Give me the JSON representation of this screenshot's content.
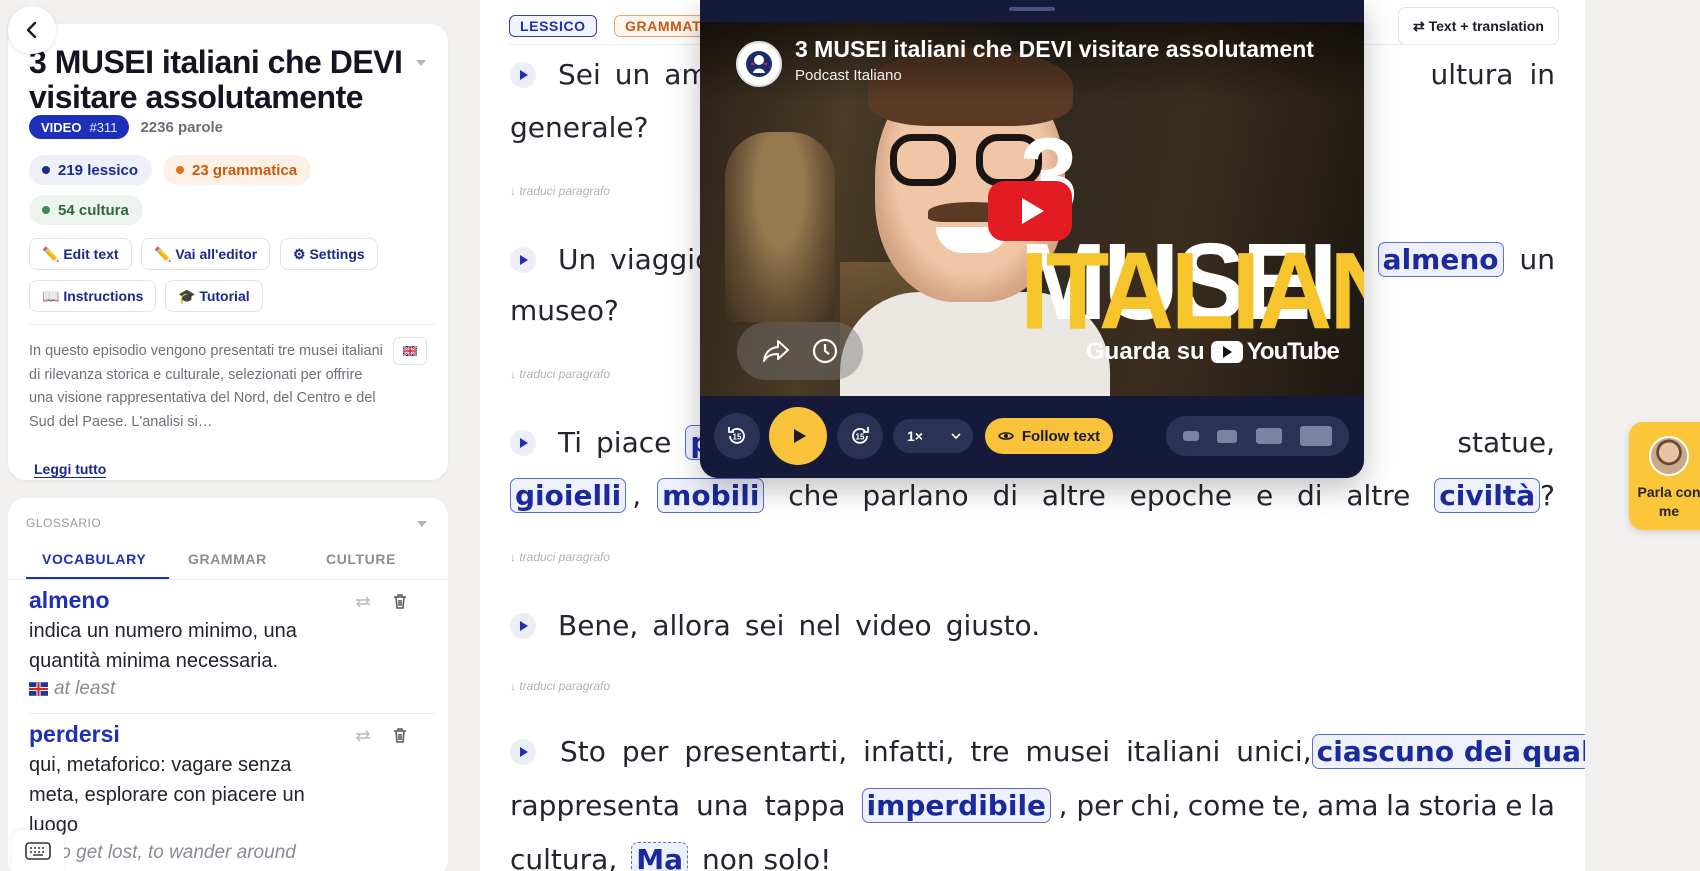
{
  "sidebar": {
    "title": "3 MUSEI italiani che DEVI visitare assolutamente",
    "video_badge": "VIDEO",
    "video_number": "#311",
    "word_count": "2236 parole",
    "stats": {
      "lessico": "219 lessico",
      "grammatica": "23 grammatica",
      "cultura": "54 cultura"
    },
    "buttons": {
      "edit_text": "✏️ Edit text",
      "editor": "✏️ Vai all'editor",
      "settings": "⚙ Settings",
      "instructions": "📖 Instructions",
      "tutorial": "🎓 Tutorial"
    },
    "description": "In questo episodio vengono presentati tre musei italiani di rilevanza storica e culturale, selezionati per offrire una visione rappresentativa del Nord, del Centro e del Sud del Paese. L'analisi si…",
    "read_all": "Leggi tutto"
  },
  "glossary": {
    "label": "GLOSSARIO",
    "tabs": [
      "VOCABULARY",
      "GRAMMAR",
      "CULTURE"
    ],
    "entries": [
      {
        "term": "almeno",
        "definition": "indica un numero minimo, una quantità minima necessaria.",
        "translation": "at least"
      },
      {
        "term": "perdersi",
        "definition": "qui, metaforico: vagare senza meta, esplorare con piacere un luogo",
        "translation": "to get lost, to wander around"
      }
    ]
  },
  "reader": {
    "tags": {
      "lessico": "LESSICO",
      "grammatica": "GRAMMATICA"
    },
    "translation_toggle": "⇄ Text + translation",
    "translate_hint": "↓ traduci paragrafo",
    "paragraphs": {
      "p1": {
        "lead": [
          "Sei",
          "un",
          "ama"
        ],
        "tail": [
          "ultura",
          "in"
        ],
        "line2": "generale?"
      },
      "p2": {
        "lead": [
          "Un",
          "viaggio,"
        ],
        "hl": "almeno",
        "tail": "un",
        "line2": "museo?"
      },
      "p3": {
        "lead": [
          "Ti",
          "piace"
        ],
        "hl_cut": "pe",
        "tail": "statue,",
        "line2_hl": [
          "gioielli",
          "mobili",
          "civiltà"
        ],
        "line2_text": [
          "che",
          "parlano",
          "di",
          "altre",
          "epoche",
          "e",
          "di",
          "altre"
        ]
      },
      "p4": {
        "words": [
          "Bene,",
          "allora",
          "sei",
          "nel",
          "video",
          "giusto."
        ]
      },
      "p5": {
        "lead": [
          "Sto",
          "per",
          "presentarti,",
          "infatti,",
          "tre",
          "musei",
          "italiani",
          "unici,"
        ],
        "hl1": "ciascuno dei quali",
        "line2a": [
          "rappresenta",
          "una",
          "tappa"
        ],
        "hl2": "imperdibile",
        "line2b": [
          ", per",
          "chi,",
          "come",
          "te,",
          "ama",
          "la",
          "storia",
          "e",
          "la"
        ],
        "line3a": "cultura,",
        "hl3": "Ma",
        "line3b": "non solo!"
      }
    }
  },
  "player": {
    "video_title": "3 MUSEI italiani che DEVI visitare assolutamente",
    "channel": "Podcast Italiano",
    "thumb_line1": "3 MUSEI",
    "thumb_line2": "ITALIANI",
    "watch_on": "Guarda su",
    "youtube": "YouTube",
    "rewind": "15",
    "forward": "15",
    "speed": "1×",
    "follow_text": "Follow text"
  },
  "chat_widget": {
    "label": "Parla con me"
  },
  "colors": {
    "accent_blue": "#1e2fb9",
    "accent_yellow": "#f8c23a",
    "grammar_orange": "#c75a10",
    "culture_green": "#2e6a3b"
  }
}
